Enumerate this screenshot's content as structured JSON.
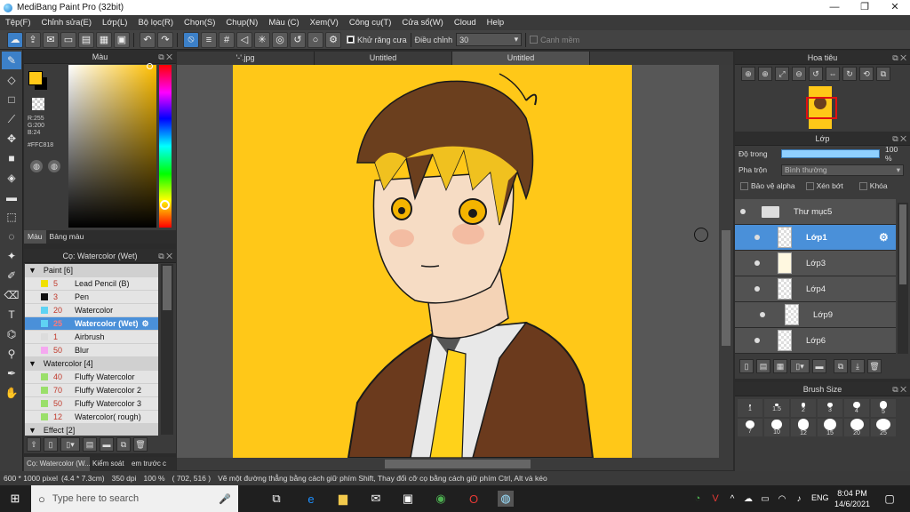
{
  "window": {
    "title": "MediBang Paint Pro (32bit)",
    "minimize": "—",
    "maximize": "❐",
    "close": "✕"
  },
  "menu": [
    "Tệp(F)",
    "Chỉnh sửa(E)",
    "Lớp(L)",
    "Bộ lọc(R)",
    "Chọn(S)",
    "Chụp(N)",
    "Màu (C)",
    "Xem(V)",
    "Công cụ(T)",
    "Cửa sổ(W)",
    "Cloud",
    "Help"
  ],
  "toolbar": {
    "antialias_label": "Khử răng cưa",
    "adjust_label": "Điều chỉnh",
    "adjust_value": "30",
    "edge_label": "Canh mềm"
  },
  "color_panel": {
    "title": "Màu",
    "r": "R:255",
    "g": "G:200",
    "b": "B:24",
    "hex": "#FFC818",
    "fg_color": "#FFC818",
    "bg_color": "#000000",
    "tab_color": "Màu",
    "tab_palette": "Bảng màu"
  },
  "brush_panel": {
    "title": "Cọ: Watercolor (Wet)",
    "groups": [
      {
        "name": "Paint [6]",
        "items": [
          {
            "size": "5",
            "name": "Lead Pencil (B)",
            "color": "#f0e000"
          },
          {
            "size": "3",
            "name": "Pen",
            "color": "#111111"
          },
          {
            "size": "20",
            "name": "Watercolor",
            "color": "#5fd3f3"
          },
          {
            "size": "25",
            "name": "Watercolor (Wet)",
            "color": "#5fd3f3",
            "selected": true
          },
          {
            "size": "1",
            "name": "Airbrush",
            "color": "#dcdcdc"
          },
          {
            "size": "50",
            "name": "Blur",
            "color": "#f5a8f0"
          }
        ]
      },
      {
        "name": "Watercolor [4]",
        "items": [
          {
            "size": "40",
            "name": "Fluffy Watercolor",
            "color": "#9adf6a"
          },
          {
            "size": "70",
            "name": "Fluffy Watercolor 2",
            "color": "#9adf6a"
          },
          {
            "size": "50",
            "name": "Fluffy Watercolor 3",
            "color": "#9adf6a"
          },
          {
            "size": "12",
            "name": "Watercolor( rough)",
            "color": "#9adf6a"
          }
        ]
      },
      {
        "name": "Effect [2]",
        "items": []
      }
    ]
  },
  "bottom_tabs": [
    "Cọ: Watercolor (W...",
    "Kiểm soát",
    "em trước c"
  ],
  "doc_tabs": [
    "'-'.jpg",
    "Untitled",
    "Untitled"
  ],
  "status": {
    "size": "600 * 1000 pixel",
    "physical": "(4.4 * 7.3cm)",
    "dpi": "350 dpi",
    "zoom": "100 %",
    "coords": "( 702, 516 )",
    "hint": "Vẽ một đường thẳng bằng cách giữ phím Shift, Thay đổi cỡ cọ bằng cách giữ phím Ctrl, Alt và kéo"
  },
  "navigator": {
    "title": "Hoa tiêu"
  },
  "layer_panel": {
    "title": "Lớp",
    "opacity_label": "Độ trong",
    "opacity_value": "100 %",
    "opacity": 1.0,
    "blend_label": "Pha trộn",
    "blend_value": "Bình thường",
    "protect_alpha": "Bảo vệ alpha",
    "clip": "Xén bớt",
    "lock": "Khóa",
    "layers": [
      {
        "name": "Thư mục5",
        "type": "folder"
      },
      {
        "name": "Lớp1",
        "selected": true
      },
      {
        "name": "Lớp3"
      },
      {
        "name": "Lớp4"
      },
      {
        "name": "Lớp9",
        "clipped": true
      },
      {
        "name": "Lớp6"
      }
    ]
  },
  "brush_size": {
    "title": "Brush Size",
    "sizes": [
      "1",
      "1.5",
      "2",
      "3",
      "4",
      "5",
      "7",
      "10",
      "12",
      "15",
      "20",
      "25"
    ]
  },
  "taskbar": {
    "search_placeholder": "Type here to search",
    "lang": "ENG",
    "time": "8:04 PM",
    "date": "14/6/2021"
  }
}
